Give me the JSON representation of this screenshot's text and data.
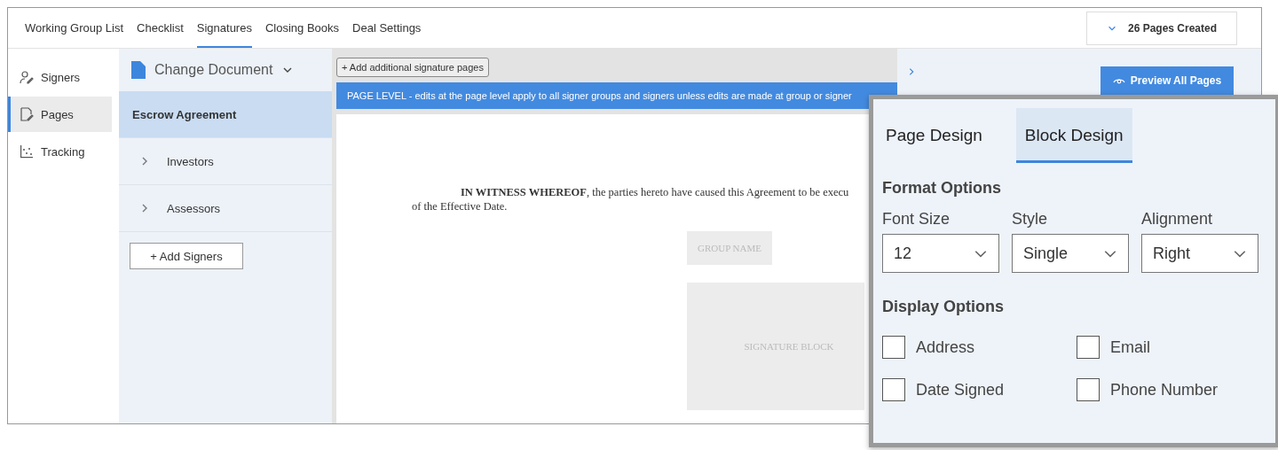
{
  "top_tabs": [
    {
      "label": "Working Group List",
      "selected": false
    },
    {
      "label": "Checklist",
      "selected": false
    },
    {
      "label": "Signatures",
      "selected": true
    },
    {
      "label": "Closing Books",
      "selected": false
    },
    {
      "label": "Deal Settings",
      "selected": false
    }
  ],
  "pages_created": "26 Pages Created",
  "sidebar": {
    "items": [
      {
        "label": "Signers",
        "kind": "signers",
        "selected": false
      },
      {
        "label": "Pages",
        "kind": "pages",
        "selected": true
      },
      {
        "label": "Tracking",
        "kind": "tracking",
        "selected": false
      }
    ]
  },
  "documents": {
    "change_document": "Change Document",
    "items": [
      {
        "label": "Escrow Agreement",
        "kind": "document",
        "selected": true
      },
      {
        "label": "Investors",
        "kind": "group",
        "selected": false
      },
      {
        "label": "Assessors",
        "kind": "group",
        "selected": false
      }
    ],
    "add_signers": "+ Add Signers"
  },
  "add_pages_button": "+ Add additional signature pages",
  "banner": "PAGE LEVEL - edits at the page level apply to all signer groups and signers unless edits are made at group or signer",
  "document_page": {
    "lines": [
      "**IN WITNESS WHEREOF**, the parties hereto have caused this Agreement to be execu",
      "of the Effective Date."
    ],
    "group_name": "GROUP NAME",
    "signature_block": "SIGNATURE BLOCK"
  },
  "preview_button": "Preview All Pages",
  "design_panel": {
    "tabs": [
      {
        "label": "Page Design",
        "selected": false
      },
      {
        "label": "Block Design",
        "selected": true
      }
    ],
    "format_heading": "Format Options",
    "selects": [
      {
        "label": "Font Size",
        "value": "12"
      },
      {
        "label": "Style",
        "value": "Single"
      },
      {
        "label": "Alignment",
        "value": "Right"
      }
    ],
    "display_heading": "Display Options",
    "checkboxes": [
      {
        "label": "Address",
        "checked": false
      },
      {
        "label": "Email",
        "checked": false
      },
      {
        "label": "Date Signed",
        "checked": false
      },
      {
        "label": "Phone Number",
        "checked": false
      }
    ]
  }
}
